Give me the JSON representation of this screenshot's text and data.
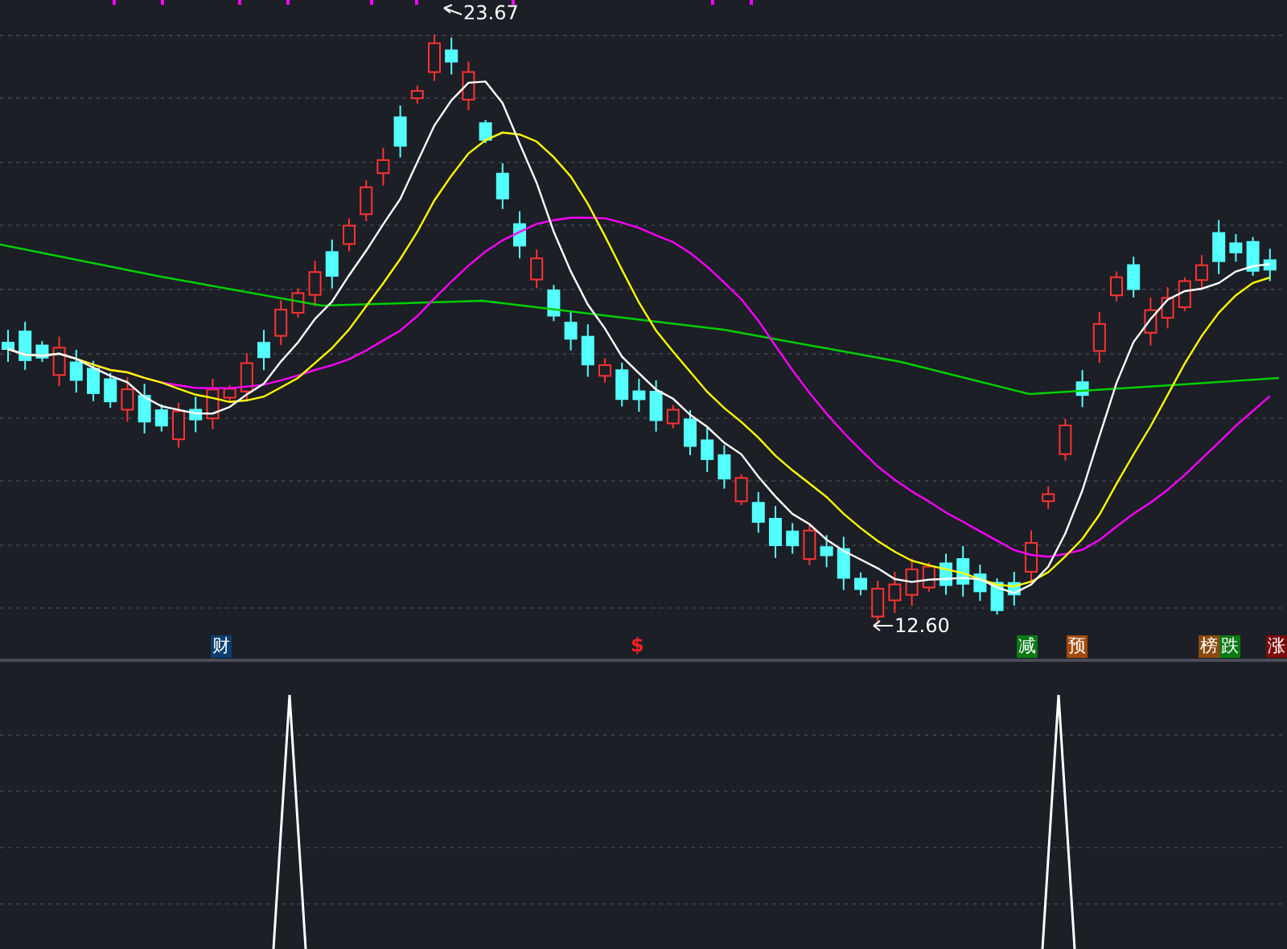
{
  "price_labels": [
    {
      "text": "23.67",
      "kind": "high"
    },
    {
      "text": "12.60",
      "kind": "low"
    }
  ],
  "event_markers": [
    {
      "label": "财",
      "kind": "badge",
      "color": "#0b3d6e"
    },
    {
      "label": "$",
      "kind": "glyph",
      "color": "#ff2020"
    },
    {
      "label": "减",
      "kind": "badge",
      "color": "#0a7a14"
    },
    {
      "label": "预",
      "kind": "badge",
      "color": "#a44a0c"
    },
    {
      "label": "榜",
      "kind": "badge",
      "color": "#8c4a10"
    },
    {
      "label": "跌",
      "kind": "badge",
      "color": "#0a7a14"
    },
    {
      "label": "涨",
      "kind": "badge",
      "color": "#7a0c0c"
    }
  ]
}
